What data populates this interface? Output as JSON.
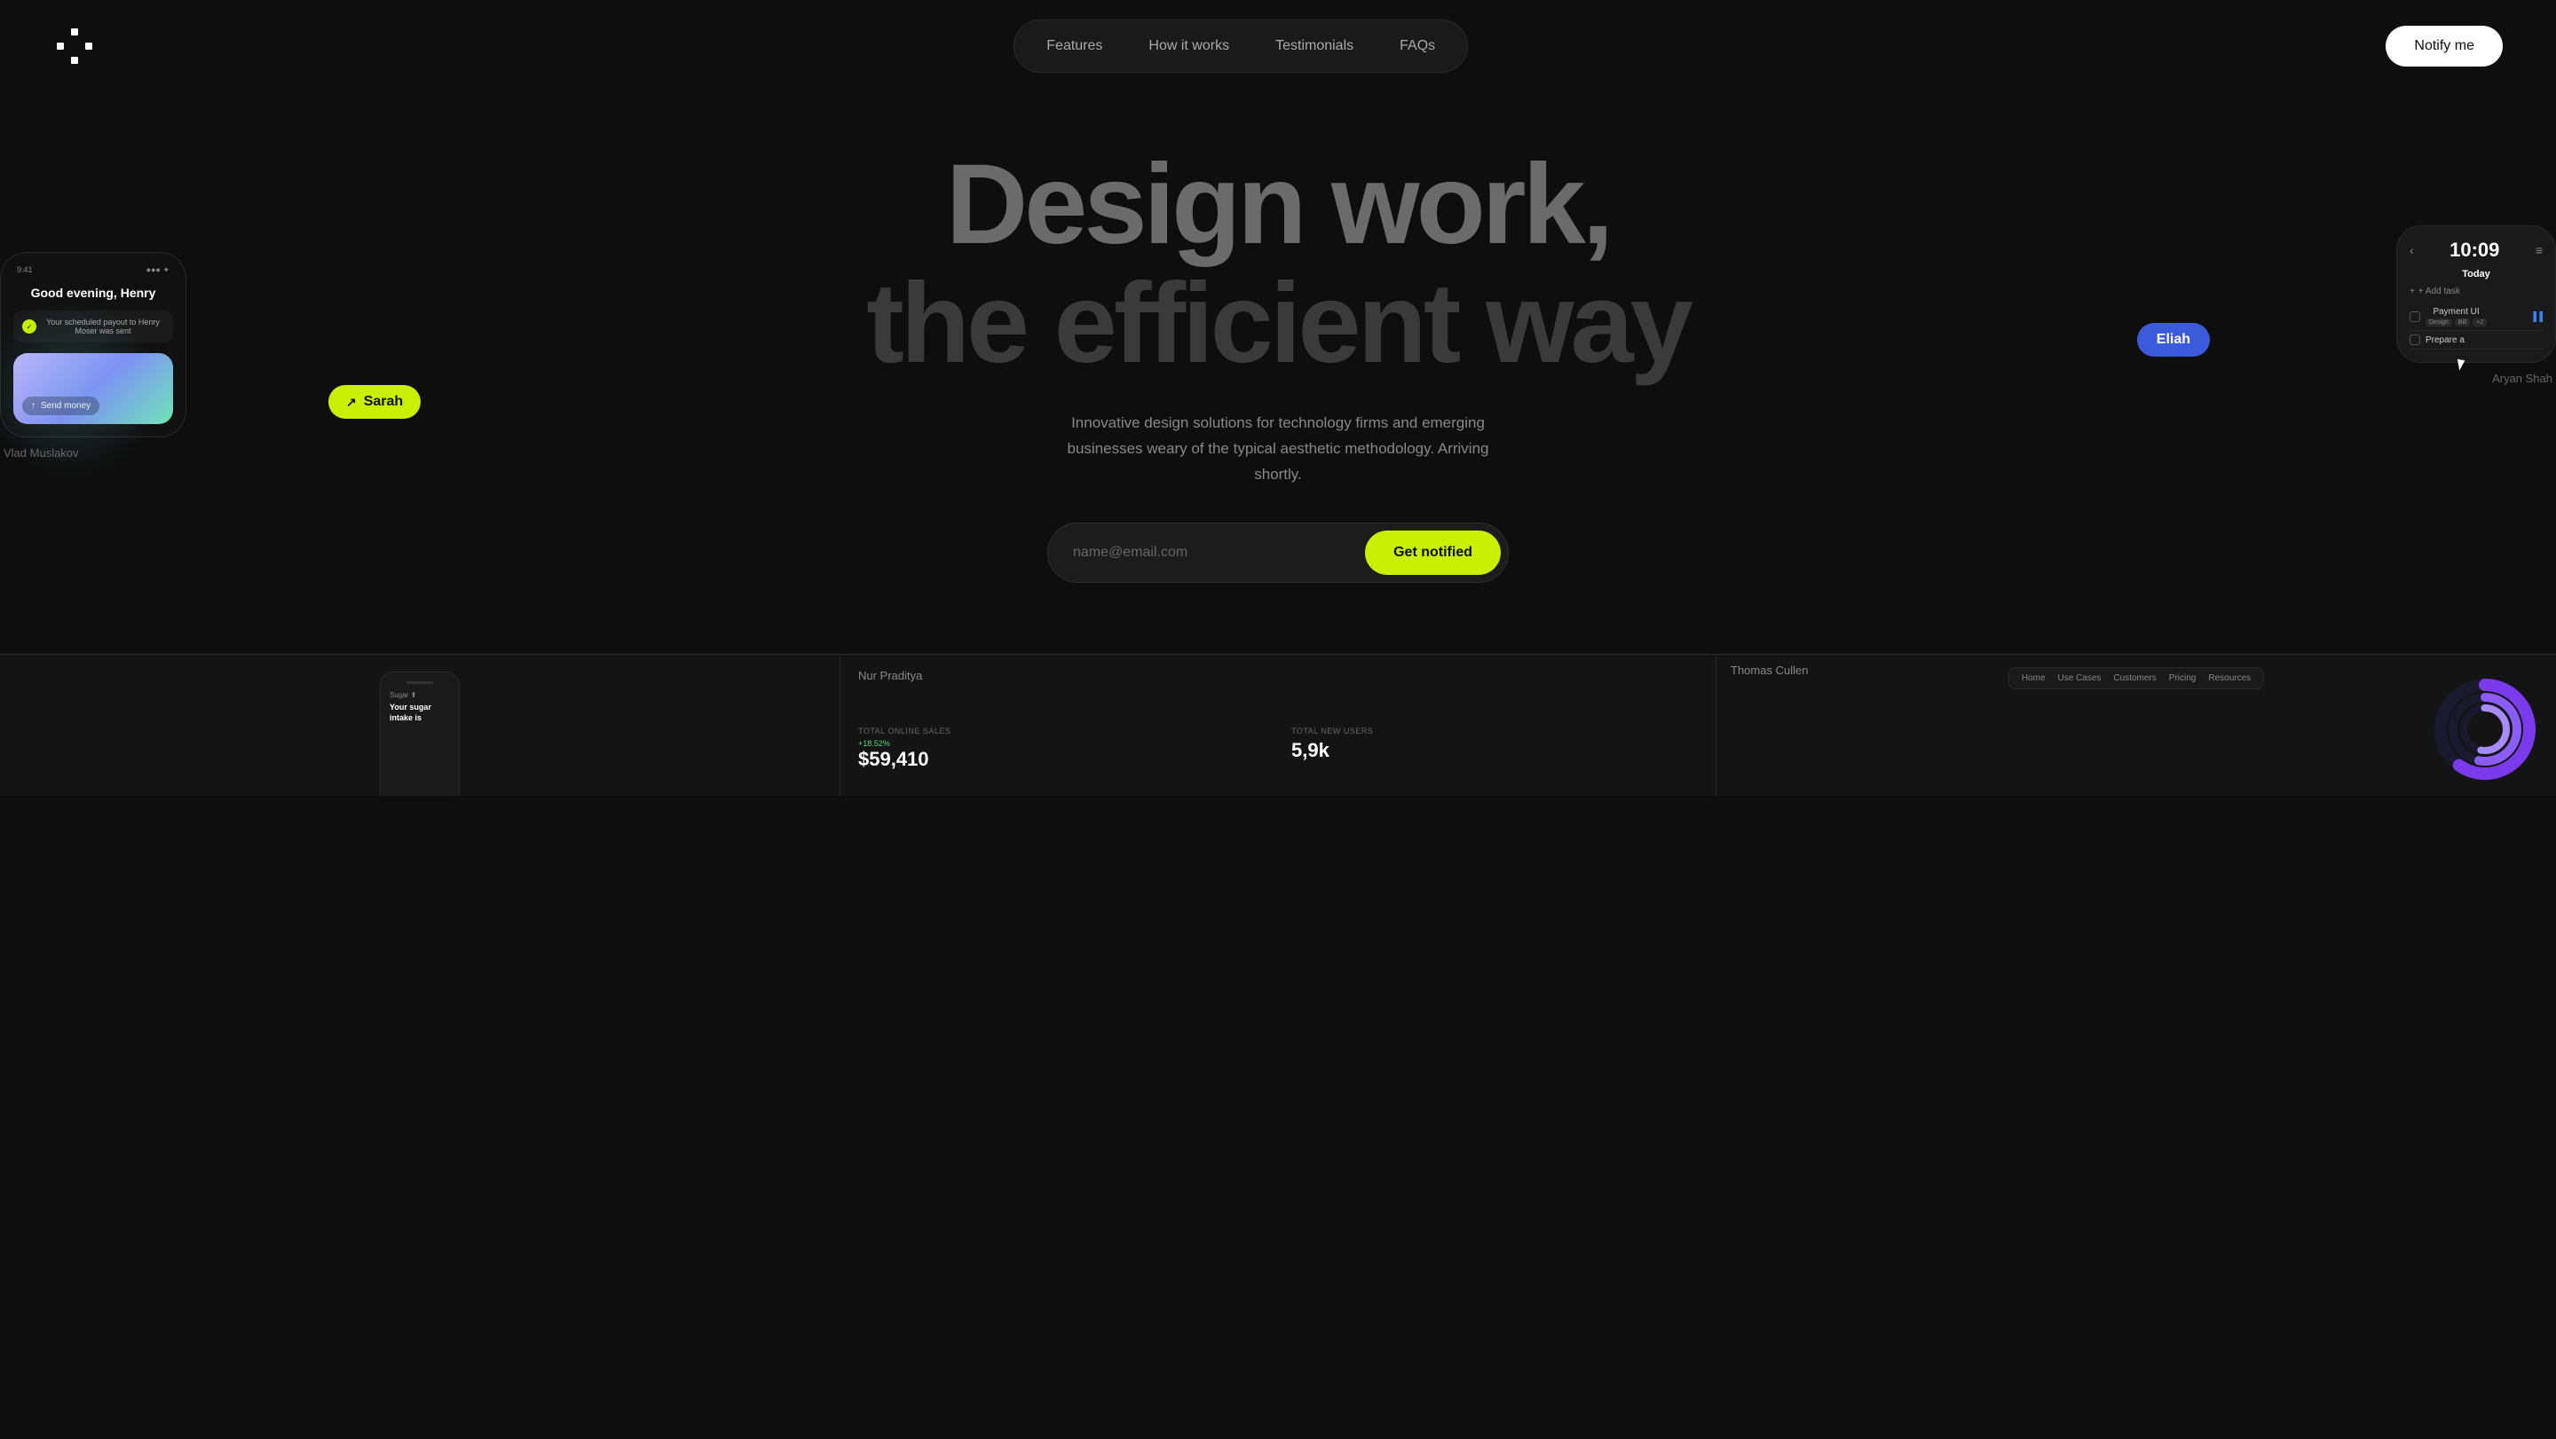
{
  "nav": {
    "items": [
      {
        "label": "Features",
        "id": "features"
      },
      {
        "label": "How it works",
        "id": "how-it-works"
      },
      {
        "label": "Testimonials",
        "id": "testimonials"
      },
      {
        "label": "FAQs",
        "id": "faqs"
      }
    ],
    "notify_button": "Notify me"
  },
  "hero": {
    "title_line1": "Design work,",
    "title_line2": "the efficient way",
    "subtitle": "Innovative design solutions for technology firms and emerging businesses weary of the typical aesthetic methodology. Arriving shortly.",
    "email_placeholder": "name@email.com",
    "cta_button": "Get notified"
  },
  "floating_cards": {
    "left": {
      "name": "Vlad Muslakov",
      "phone_time": "9:41",
      "greeting": "Good evening, Henry",
      "notification": "Your scheduled payout to Henry Moser was sent",
      "send_money_label": "Send money"
    },
    "tag_sarah": "Sarah",
    "tag_eliah": "Eliah",
    "right": {
      "name": "Aryan Shah",
      "watch_time": "10:09",
      "today_label": "Today",
      "add_task": "+ Add task",
      "task1": "Payment UI",
      "task1_tags": [
        "Design",
        "Bill",
        "+2"
      ],
      "task2": "Prepare a"
    }
  },
  "gallery": {
    "items": [
      {
        "label": "",
        "type": "phone"
      },
      {
        "label": "Nur Praditya",
        "type": "dashboard",
        "stats": {
          "sales_label": "TOTAL ONLINE SALES",
          "sales_value": "$59,410",
          "sales_change": "+18.52%",
          "users_label": "TOTAL NEW USERS",
          "users_value": "5,9k"
        }
      },
      {
        "label": "Thomas Cullen",
        "type": "circular"
      }
    ]
  }
}
